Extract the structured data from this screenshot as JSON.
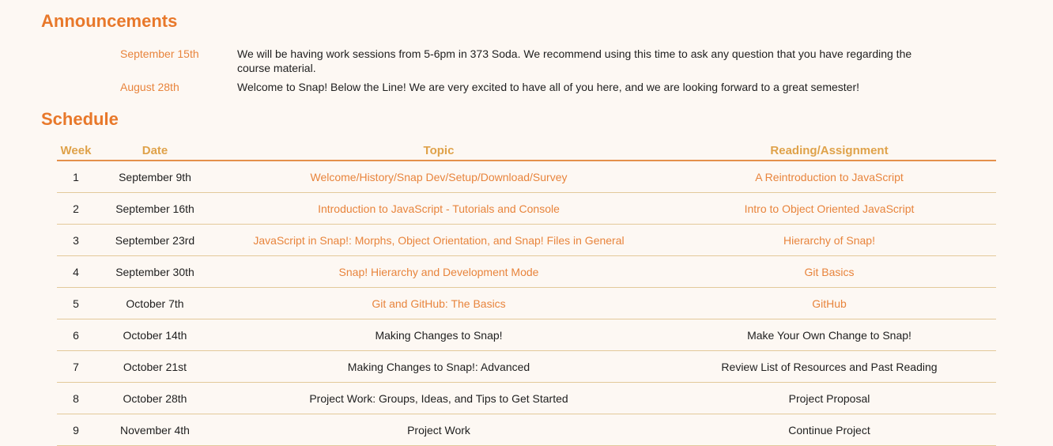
{
  "announcements": {
    "title": "Announcements",
    "items": [
      {
        "date": "September 15th",
        "text": "We will be having work sessions from 5-6pm in 373 Soda. We recommend using this time to ask any question that you have regarding the course material."
      },
      {
        "date": "August 28th",
        "text": "Welcome to Snap! Below the Line! We are very excited to have all of you here, and we are looking forward to a great semester!"
      }
    ]
  },
  "schedule": {
    "title": "Schedule",
    "headers": {
      "week": "Week",
      "date": "Date",
      "topic": "Topic",
      "reading": "Reading/Assignment"
    },
    "rows": [
      {
        "week": "1",
        "date": "September 9th",
        "topic": "Welcome/History/Snap Dev/Setup/Download/Survey",
        "reading": "A Reintroduction to JavaScript"
      },
      {
        "week": "2",
        "date": "September 16th",
        "topic": "Introduction to JavaScript - Tutorials and Console",
        "reading": "Intro to Object Oriented JavaScript"
      },
      {
        "week": "3",
        "date": "September 23rd",
        "topic": "JavaScript in Snap!: Morphs, Object Orientation, and Snap! Files in General",
        "reading": "Hierarchy of Snap!"
      },
      {
        "week": "4",
        "date": "September 30th",
        "topic": "Snap! Hierarchy and Development Mode",
        "reading": "Git Basics"
      },
      {
        "week": "5",
        "date": "October 7th",
        "topic": "Git and GitHub: The Basics",
        "reading": "GitHub"
      },
      {
        "week": "6",
        "date": "October 14th",
        "topic": "Making Changes to Snap!",
        "reading": "Make Your Own Change to Snap!"
      },
      {
        "week": "7",
        "date": "October 21st",
        "topic": "Making Changes to Snap!: Advanced",
        "reading": "Review List of Resources and Past Reading"
      },
      {
        "week": "8",
        "date": "October 28th",
        "topic": "Project Work: Groups, Ideas, and Tips to Get Started",
        "reading": "Project Proposal"
      },
      {
        "week": "9",
        "date": "November 4th",
        "topic": "Project Work",
        "reading": "Continue Project"
      }
    ]
  },
  "colors": {
    "background": "#fdf8f3",
    "heading": "#e8782a",
    "link": "#e8843c",
    "table_header": "#dfa24a",
    "row_divider": "#e3c99a"
  }
}
